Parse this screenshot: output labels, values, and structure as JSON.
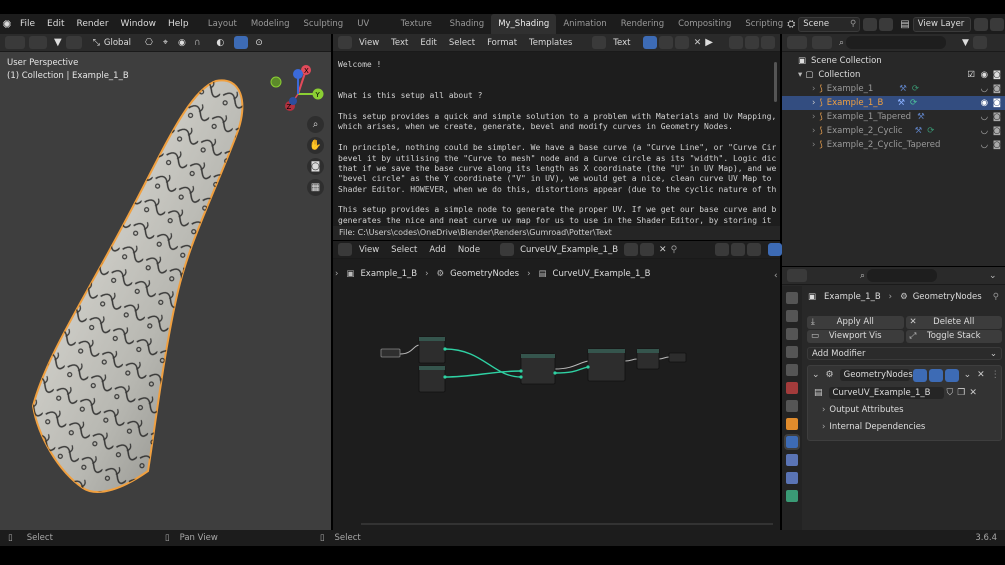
{
  "menubar": {
    "items": [
      "File",
      "Edit",
      "Render",
      "Window",
      "Help"
    ],
    "workspaces": [
      "Layout",
      "Modeling",
      "Sculpting",
      "UV Editing",
      "Texture Paint",
      "Shading",
      "My_Shading",
      "Animation",
      "Rendering",
      "Compositing",
      "Scripting"
    ],
    "active_workspace": "My_Shading",
    "scene": "Scene",
    "view_layer": "View Layer"
  },
  "viewport": {
    "transform_orientation": "Global",
    "title": "User Perspective",
    "subtitle": "(1) Collection | Example_1_B",
    "gizmo": {
      "x": "X",
      "y": "Y",
      "z": "Z"
    }
  },
  "text_editor": {
    "menu": [
      "View",
      "Text",
      "Edit",
      "Select",
      "Format",
      "Templates"
    ],
    "datablock": "Text",
    "lines": [
      "Welcome !",
      "",
      "",
      "What is this setup all about ?",
      "",
      "This setup provides a quick and simple solution to a problem with Materials and Uv Mapping,",
      "which arises, when we create, generate, bevel and modify curves in Geometry Nodes.",
      "",
      "In principle, nothing could be simpler. We have a base curve (a \"Curve Line\", or \"Curve Circ",
      "bevel it by utilising the \"Curve to mesh\" node and a Curve circle as its \"width\". Logic dict",
      "that if we save the base curve along its length as X coordinate (the \"U\" in UV Map), and we",
      "\"bevel circle\" as the Y coordinate (\"V\" in UV), we would get a nice, clean curve UV Map to u",
      "Shader Editor. HOWEVER, when we do this, distortions appear (due to the cyclic nature of the",
      "",
      "This setup provides a simple node to generate the proper UV. If we get our base curve and be",
      "generates the nice and neat curve uv map for us to use in the Shader Editor, by storing it i"
    ],
    "file_path": "File: C:\\Users\\codes\\OneDrive\\Blender\\Renders\\Gumroad\\Potter\\Text"
  },
  "node_editor": {
    "menu": [
      "View",
      "Select",
      "Add",
      "Node"
    ],
    "node_tree": "CurveUV_Example_1_B",
    "breadcrumb": [
      "Example_1_B",
      "GeometryNodes",
      "CurveUV_Example_1_B"
    ]
  },
  "outliner": {
    "root": "Scene Collection",
    "collection": "Collection",
    "items": [
      {
        "name": "Example_1",
        "selected": false
      },
      {
        "name": "Example_1_B",
        "selected": true
      },
      {
        "name": "Example_1_Tapered",
        "selected": false
      },
      {
        "name": "Example_2_Cyclic",
        "selected": false
      },
      {
        "name": "Example_2_Cyclic_Tapered",
        "selected": false
      }
    ]
  },
  "properties": {
    "object": "Example_1_B",
    "modifier_context": "GeometryNodes",
    "apply_all": "Apply All",
    "delete_all": "Delete All",
    "viewport_vis": "Viewport Vis",
    "toggle_stack": "Toggle Stack",
    "add_modifier": "Add Modifier",
    "modifier_name": "GeometryNodes",
    "node_group": "CurveUV_Example_1_B",
    "panels": [
      "Output Attributes",
      "Internal Dependencies"
    ]
  },
  "statusbar": {
    "left": "Select",
    "middle": "Pan View",
    "right": "Select",
    "version": "3.6.4"
  },
  "colors": {
    "accent_blue": "#3d6bb5",
    "selection_orange": "#f0a040",
    "node_link": "#2fd1a3"
  }
}
